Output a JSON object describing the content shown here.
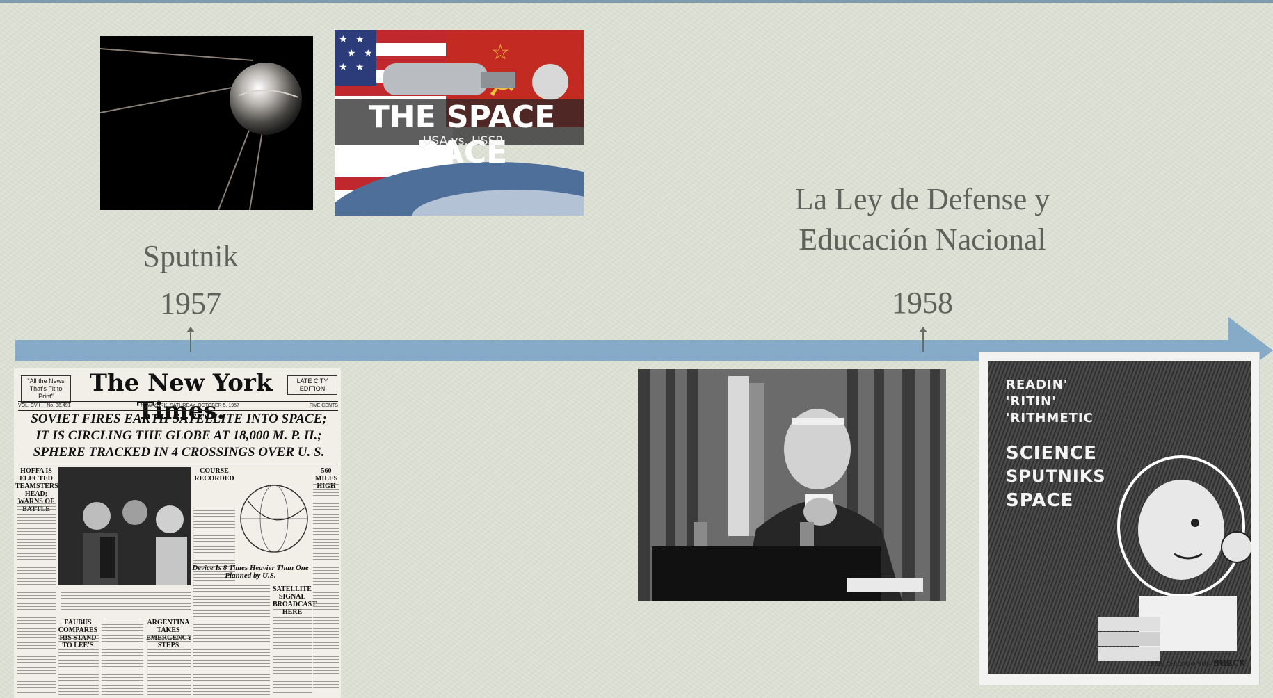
{
  "timeline": {
    "events": [
      {
        "title": "Sputnik",
        "year": "1957"
      },
      {
        "title_line1": "La Ley de Defense y",
        "title_line2": "Educación Nacional",
        "year": "1958"
      }
    ]
  },
  "images": {
    "space_race": {
      "title": "THE SPACE RACE",
      "subtitle": "USA vs. USSR"
    },
    "newspaper": {
      "masthead": "The New York Times.",
      "ear_left": "\"All the News That's Fit to Print\"",
      "ear_right": "LATE CITY EDITION",
      "dateline_left": "VOL. CVII . . No. 36,491",
      "dateline_center": "NEW YORK, SATURDAY, OCTOBER 5, 1957",
      "dateline_right": "FIVE CENTS",
      "headline_1": "SOVIET FIRES EARTH SATELLITE INTO SPACE;",
      "headline_2": "IT IS CIRCLING THE GLOBE AT 18,000 M. P. H.;",
      "headline_3": "SPHERE TRACKED IN 4 CROSSINGS OVER U. S.",
      "sub_left": "HOFFA IS ELECTED TEAMSTERS' HEAD; WARNS OF BATTLE",
      "sub_mid": "COURSE RECORDED",
      "sub_right": "560 MILES HIGH",
      "sub_device": "Device Is 8 Times Heavier Than One Planned by U.S.",
      "sub_faubus": "FAUBUS COMPARES HIS STAND TO LEE'S",
      "sub_argentina": "ARGENTINA TAKES EMERGENCY STEPS",
      "sub_signal": "SATELLITE SIGNAL BROADCAST HERE"
    },
    "cartoon": {
      "line1": "READIN'",
      "line2": "'RITIN'",
      "line3": "'RITHMETIC",
      "line4": "SCIENCE",
      "line5": "SPUTNIKS",
      "line6": "SPACE",
      "signature": "BURCK",
      "credit": "1958, CHICAGO SUN-TIMES"
    }
  },
  "colors": {
    "background": "#dfe3d6",
    "timeline": "#86abc8",
    "text": "#5f615a"
  }
}
